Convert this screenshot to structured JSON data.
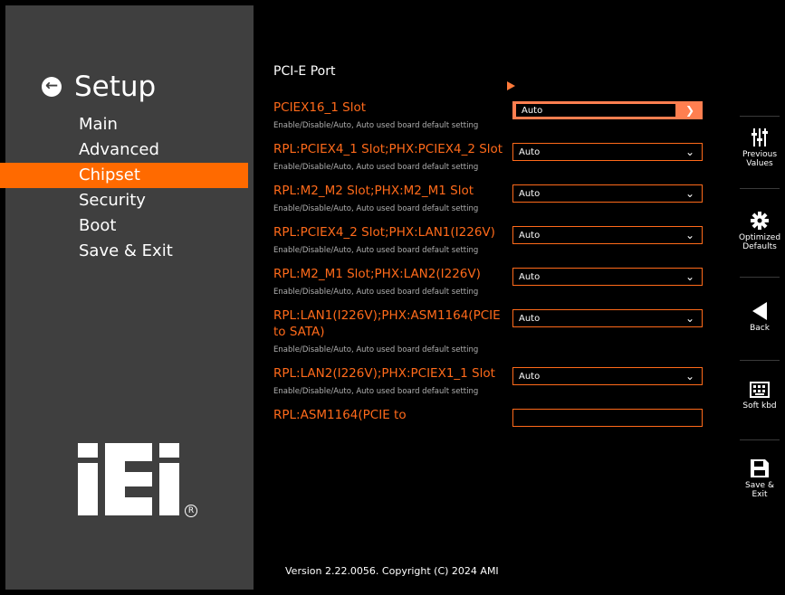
{
  "sidebar": {
    "title": "Setup",
    "back_icon": "arrow-left-icon",
    "menu": [
      {
        "label": "Main"
      },
      {
        "label": "Advanced"
      },
      {
        "label": "Chipset"
      },
      {
        "label": "Security"
      },
      {
        "label": "Boot"
      },
      {
        "label": "Save & Exit"
      }
    ],
    "active_item": "Chipset",
    "logo_text": "iEi"
  },
  "main": {
    "section_title": "PCI-E Port",
    "settings": [
      {
        "label": "PCIEX16_1 Slot",
        "help": "Enable/Disable/Auto, Auto used board default setting",
        "value": "Auto"
      },
      {
        "label": "RPL:PCIEX4_1 Slot;PHX:PCIEX4_2 Slot",
        "help": "Enable/Disable/Auto, Auto used board default setting",
        "value": "Auto"
      },
      {
        "label": "RPL:M2_M2 Slot;PHX:M2_M1 Slot",
        "help": "Enable/Disable/Auto, Auto used board default setting",
        "value": "Auto"
      },
      {
        "label": "RPL:PCIEX4_2 Slot;PHX:LAN1(I226V)",
        "help": "Enable/Disable/Auto, Auto used board default setting",
        "value": "Auto"
      },
      {
        "label": "RPL:M2_M1 Slot;PHX:LAN2(I226V)",
        "help": "Enable/Disable/Auto, Auto used board default setting",
        "value": "Auto"
      },
      {
        "label": "RPL:LAN1(I226V);PHX:ASM1164(PCIE to SATA)",
        "help": "Enable/Disable/Auto, Auto used board default setting",
        "value": "Auto"
      },
      {
        "label": "RPL:LAN2(I226V);PHX:PCIEX1_1 Slot",
        "help": "Enable/Disable/Auto, Auto used board default setting",
        "value": "Auto"
      },
      {
        "label": "RPL:ASM1164(PCIE to",
        "help": "",
        "value": ""
      }
    ],
    "version": "Version 2.22.0056. Copyright (C) 2024 AMI"
  },
  "toolbar": {
    "items": [
      {
        "label": "Previous Values",
        "icon": "sliders-icon"
      },
      {
        "label": "Optimized Defaults",
        "icon": "gear-icon"
      },
      {
        "label": "Back",
        "icon": "triangle-left-icon"
      },
      {
        "label": "Soft kbd",
        "icon": "keyboard-icon"
      },
      {
        "label": "Save & Exit",
        "icon": "floppy-icon"
      }
    ]
  },
  "colors": {
    "accent": "#ff6a00",
    "label_orange": "#ff6a1a",
    "selected_dropdown": "#ff7f50",
    "sidebar_bg": "#3f3f3f"
  }
}
